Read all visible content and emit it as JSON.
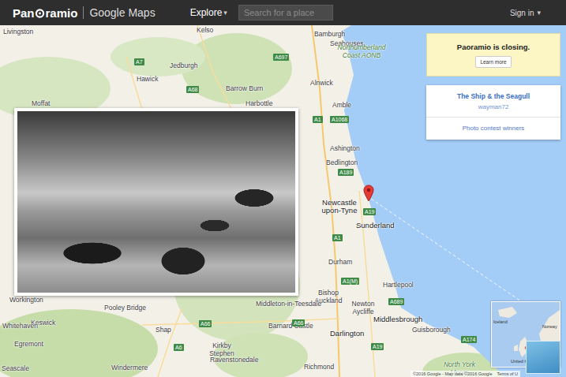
{
  "header": {
    "logo": [
      "Pan",
      "ramio"
    ],
    "product": "Google Maps",
    "explore": "Explore",
    "explore_caret": "▾",
    "search": {
      "placeholder": "Search for a place"
    },
    "sign_in": "Sign in",
    "sign_in_caret": "▾"
  },
  "notice": {
    "text": "Paoramio is closing.",
    "button": "Learn more"
  },
  "photo_card": {
    "title": "The Ship & the Seagull",
    "author": "wayman72",
    "link": "Photo contest winners"
  },
  "map": {
    "labels": [
      {
        "text": "Livingston",
        "kind": "town"
      },
      {
        "text": "Kelso",
        "kind": "town"
      },
      {
        "text": "Bamburgh",
        "kind": "town"
      },
      {
        "text": "Seahouses",
        "kind": "town"
      },
      {
        "text": "Northumberland Coast AONB",
        "kind": "region"
      },
      {
        "text": "Jedburgh",
        "kind": "town"
      },
      {
        "text": "Hawick",
        "kind": "town"
      },
      {
        "text": "Alnwick",
        "kind": "town"
      },
      {
        "text": "Barrow Burn",
        "kind": "town"
      },
      {
        "text": "Harbottle",
        "kind": "town"
      },
      {
        "text": "Amble",
        "kind": "town"
      },
      {
        "text": "Moffat",
        "kind": "town"
      },
      {
        "text": "Ashington",
        "kind": "town"
      },
      {
        "text": "Bedlington",
        "kind": "town"
      },
      {
        "text": "Newcastle upon-Tyne",
        "kind": "city"
      },
      {
        "text": "Sunderland",
        "kind": "city"
      },
      {
        "text": "Durham",
        "kind": "town"
      },
      {
        "text": "Hartlepool",
        "kind": "town"
      },
      {
        "text": "Bishop Auckland",
        "kind": "town"
      },
      {
        "text": "Newton Aycliffe",
        "kind": "town"
      },
      {
        "text": "Middlesbrough",
        "kind": "city"
      },
      {
        "text": "Workington",
        "kind": "town"
      },
      {
        "text": "Keswick",
        "kind": "town"
      },
      {
        "text": "Whitehaven",
        "kind": "town"
      },
      {
        "text": "Pooley Bridge",
        "kind": "town"
      },
      {
        "text": "Middleton-in-Teesdale",
        "kind": "town"
      },
      {
        "text": "Barnard Castle",
        "kind": "town"
      },
      {
        "text": "Darlington",
        "kind": "city"
      },
      {
        "text": "Guisborough",
        "kind": "town"
      },
      {
        "text": "Egremont",
        "kind": "town"
      },
      {
        "text": "Shap",
        "kind": "town"
      },
      {
        "text": "Kirkby Stephen",
        "kind": "town"
      },
      {
        "text": "Ravenstonedale",
        "kind": "town"
      },
      {
        "text": "Richmond",
        "kind": "town"
      },
      {
        "text": "Seascale",
        "kind": "town"
      },
      {
        "text": "Windermere",
        "kind": "town"
      },
      {
        "text": "North York Moors",
        "kind": "region"
      },
      {
        "text": "A697",
        "kind": "road"
      },
      {
        "text": "A7",
        "kind": "road"
      },
      {
        "text": "A68",
        "kind": "road"
      },
      {
        "text": "A1",
        "kind": "road"
      },
      {
        "text": "A1068",
        "kind": "road"
      },
      {
        "text": "A189",
        "kind": "road"
      },
      {
        "text": "A1",
        "kind": "road"
      },
      {
        "text": "A19",
        "kind": "road"
      },
      {
        "text": "A1(M)",
        "kind": "road"
      },
      {
        "text": "A689",
        "kind": "road"
      },
      {
        "text": "A66",
        "kind": "road"
      },
      {
        "text": "A66",
        "kind": "road"
      },
      {
        "text": "A6",
        "kind": "road"
      },
      {
        "text": "A19",
        "kind": "road"
      },
      {
        "text": "A174",
        "kind": "road"
      }
    ]
  },
  "minimap": {
    "labels": [
      "Iceland",
      "United Kingdom",
      "Norway"
    ]
  },
  "attribution": {
    "text": "©2016 Google - Map data ©2016 Google",
    "terms": "Terms of U"
  }
}
